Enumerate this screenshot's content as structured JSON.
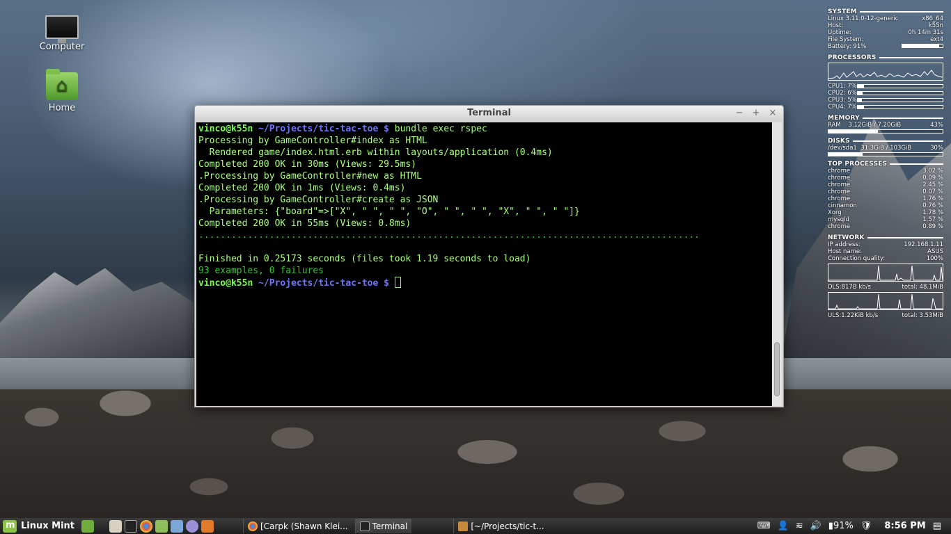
{
  "desktop": {
    "icons": [
      {
        "label": "Computer"
      },
      {
        "label": "Home"
      }
    ]
  },
  "terminal": {
    "title": "Terminal",
    "controls": {
      "minimize": "−",
      "maximize": "+",
      "close": "×"
    },
    "prompt": {
      "user": "vinco@k55n",
      "path": "~/Projects/tic-tac-toe",
      "symbol": "$"
    },
    "command": "bundle exec rspec",
    "lines": [
      "Processing by GameController#index as HTML",
      "  Rendered game/index.html.erb within layouts/application (0.4ms)",
      "Completed 200 OK in 30ms (Views: 29.5ms)",
      ".Processing by GameController#new as HTML",
      "Completed 200 OK in 1ms (Views: 0.4ms)",
      ".Processing by GameController#create as JSON",
      "  Parameters: {\"board\"=>[\"X\", \" \", \" \", \"O\", \" \", \" \", \"X\", \" \", \" \"]}",
      "Completed 200 OK in 55ms (Views: 0.8ms)"
    ],
    "dots": "............................................................................................",
    "finished": "Finished in 0.25173 seconds (files took 1.19 seconds to load)",
    "summary": "93 examples, 0 failures"
  },
  "conky": {
    "system": {
      "header": "SYSTEM",
      "rows": [
        {
          "label": "Linux 3.11.0-12-generic",
          "value": "x86_64"
        },
        {
          "label": "Host:",
          "value": "k55n"
        },
        {
          "label": "Uptime:",
          "value": "0h 14m 31s"
        },
        {
          "label": "File System:",
          "value": "ext4"
        }
      ],
      "battery_label": "Battery: 91%",
      "battery_level": 0.91
    },
    "processors": {
      "header": "PROCESSORS",
      "cpus": [
        {
          "label": "CPU1: 7%",
          "level": 0.07
        },
        {
          "label": "CPU2: 6%",
          "level": 0.06
        },
        {
          "label": "CPU3: 5%",
          "level": 0.05
        },
        {
          "label": "CPU4: 7%",
          "level": 0.07
        }
      ]
    },
    "memory": {
      "header": "MEMORY",
      "label": "RAM",
      "value": "3.12GiB / 7.20GiB",
      "percent": "43%",
      "level": 0.43
    },
    "disks": {
      "header": "DISKS",
      "label": "/dev/sda1",
      "value": "31.3GiB / 103GiB",
      "percent": "30%",
      "level": 0.3
    },
    "top_processes": {
      "header": "TOP PROCESSES",
      "rows": [
        {
          "name": "chrome",
          "value": "3.02 %"
        },
        {
          "name": "chrome",
          "value": "0.09 %"
        },
        {
          "name": "chrome",
          "value": "2.45 %"
        },
        {
          "name": "chrome",
          "value": "0.07 %"
        },
        {
          "name": "chrome",
          "value": "1.76 %"
        },
        {
          "name": "cinnamon",
          "value": "0.76 %"
        },
        {
          "name": "Xorg",
          "value": "1.78 %"
        },
        {
          "name": "mysqld",
          "value": "1.57 %"
        },
        {
          "name": "chrome",
          "value": "0.89 %"
        }
      ]
    },
    "network": {
      "header": "NETWORK",
      "rows": [
        {
          "label": "IP address:",
          "value": "192.168.1.11"
        },
        {
          "label": "Host name:",
          "value": "ASUS"
        },
        {
          "label": "Connection quality:",
          "value": "100%"
        }
      ],
      "down_left": "DLS:817B   kb/s",
      "down_total": "total: 48.1MiB",
      "up_left": "ULS:1.22KiB kb/s",
      "up_total": "total: 3.53MiB"
    }
  },
  "taskbar": {
    "menu_label": "Linux Mint",
    "tasks": [
      {
        "label": "[Carpk (Shawn Klei...",
        "icon_color": "#e0a020"
      },
      {
        "label": "Terminal",
        "icon_color": "#222222"
      },
      {
        "label": "[~/Projects/tic-t...",
        "icon_color": "#c88a3a"
      }
    ],
    "battery": "91%",
    "clock": "8:56 PM"
  },
  "colors": {
    "terminal_green": "#aaff7a",
    "prompt_blue": "#6f75ff",
    "mint_green": "#8bc34a"
  }
}
